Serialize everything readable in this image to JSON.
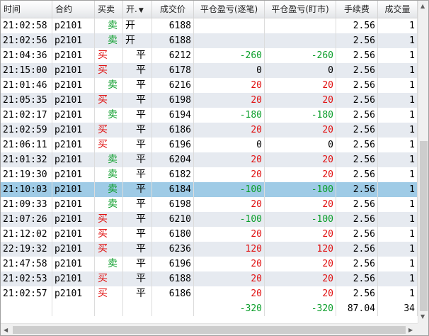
{
  "columns": [
    {
      "key": "time",
      "label": "时间",
      "width": 73
    },
    {
      "key": "contract",
      "label": "合约",
      "width": 60
    },
    {
      "key": "side",
      "label": "买卖",
      "width": 40
    },
    {
      "key": "oc",
      "label": "开.",
      "width": 41
    },
    {
      "key": "price",
      "label": "成交价",
      "width": 59
    },
    {
      "key": "pnl_trade",
      "label": "平仓盈亏(逐笔)",
      "width": 100
    },
    {
      "key": "pnl_mark",
      "label": "平仓盈亏(盯市)",
      "width": 101
    },
    {
      "key": "fee",
      "label": "手续费",
      "width": 59
    },
    {
      "key": "qty",
      "label": "成交量",
      "width": 56
    }
  ],
  "sort_indicator": "▼",
  "rows": [
    {
      "time": "21:02:58",
      "contract": "p2101",
      "side": "卖",
      "oc": "开",
      "price": "6188",
      "pnl_trade": "",
      "pnl_mark": "",
      "fee": "2.56",
      "qty": "1"
    },
    {
      "time": "21:02:56",
      "contract": "p2101",
      "side": "卖",
      "oc": "开",
      "price": "6188",
      "pnl_trade": "",
      "pnl_mark": "",
      "fee": "2.56",
      "qty": "1"
    },
    {
      "time": "21:04:36",
      "contract": "p2101",
      "side": "买",
      "oc": "平",
      "price": "6212",
      "pnl_trade": "-260",
      "pnl_mark": "-260",
      "fee": "2.56",
      "qty": "1"
    },
    {
      "time": "21:15:00",
      "contract": "p2101",
      "side": "买",
      "oc": "平",
      "price": "6178",
      "pnl_trade": "0",
      "pnl_mark": "0",
      "fee": "2.56",
      "qty": "1"
    },
    {
      "time": "21:01:46",
      "contract": "p2101",
      "side": "卖",
      "oc": "平",
      "price": "6216",
      "pnl_trade": "20",
      "pnl_mark": "20",
      "fee": "2.56",
      "qty": "1"
    },
    {
      "time": "21:05:35",
      "contract": "p2101",
      "side": "买",
      "oc": "平",
      "price": "6198",
      "pnl_trade": "20",
      "pnl_mark": "20",
      "fee": "2.56",
      "qty": "1"
    },
    {
      "time": "21:02:17",
      "contract": "p2101",
      "side": "卖",
      "oc": "平",
      "price": "6194",
      "pnl_trade": "-180",
      "pnl_mark": "-180",
      "fee": "2.56",
      "qty": "1"
    },
    {
      "time": "21:02:59",
      "contract": "p2101",
      "side": "买",
      "oc": "平",
      "price": "6186",
      "pnl_trade": "20",
      "pnl_mark": "20",
      "fee": "2.56",
      "qty": "1"
    },
    {
      "time": "21:06:11",
      "contract": "p2101",
      "side": "买",
      "oc": "平",
      "price": "6196",
      "pnl_trade": "0",
      "pnl_mark": "0",
      "fee": "2.56",
      "qty": "1"
    },
    {
      "time": "21:01:32",
      "contract": "p2101",
      "side": "卖",
      "oc": "平",
      "price": "6204",
      "pnl_trade": "20",
      "pnl_mark": "20",
      "fee": "2.56",
      "qty": "1"
    },
    {
      "time": "21:19:30",
      "contract": "p2101",
      "side": "卖",
      "oc": "平",
      "price": "6182",
      "pnl_trade": "20",
      "pnl_mark": "20",
      "fee": "2.56",
      "qty": "1"
    },
    {
      "time": "21:10:03",
      "contract": "p2101",
      "side": "卖",
      "oc": "平",
      "price": "6184",
      "pnl_trade": "-100",
      "pnl_mark": "-100",
      "fee": "2.56",
      "qty": "1",
      "selected": true
    },
    {
      "time": "21:09:33",
      "contract": "p2101",
      "side": "卖",
      "oc": "平",
      "price": "6198",
      "pnl_trade": "20",
      "pnl_mark": "20",
      "fee": "2.56",
      "qty": "1"
    },
    {
      "time": "21:07:26",
      "contract": "p2101",
      "side": "买",
      "oc": "平",
      "price": "6210",
      "pnl_trade": "-100",
      "pnl_mark": "-100",
      "fee": "2.56",
      "qty": "1"
    },
    {
      "time": "21:12:02",
      "contract": "p2101",
      "side": "买",
      "oc": "平",
      "price": "6180",
      "pnl_trade": "20",
      "pnl_mark": "20",
      "fee": "2.56",
      "qty": "1"
    },
    {
      "time": "22:19:32",
      "contract": "p2101",
      "side": "买",
      "oc": "平",
      "price": "6236",
      "pnl_trade": "120",
      "pnl_mark": "120",
      "fee": "2.56",
      "qty": "1"
    },
    {
      "time": "21:47:58",
      "contract": "p2101",
      "side": "卖",
      "oc": "平",
      "price": "6196",
      "pnl_trade": "20",
      "pnl_mark": "20",
      "fee": "2.56",
      "qty": "1"
    },
    {
      "time": "21:02:53",
      "contract": "p2101",
      "side": "买",
      "oc": "平",
      "price": "6188",
      "pnl_trade": "20",
      "pnl_mark": "20",
      "fee": "2.56",
      "qty": "1"
    },
    {
      "time": "21:02:57",
      "contract": "p2101",
      "side": "买",
      "oc": "平",
      "price": "6186",
      "pnl_trade": "20",
      "pnl_mark": "20",
      "fee": "2.56",
      "qty": "1"
    }
  ],
  "totals": {
    "time": "",
    "contract": "",
    "side": "",
    "oc": "",
    "price": "",
    "pnl_trade": "-320",
    "pnl_mark": "-320",
    "fee": "87.04",
    "qty": "34"
  },
  "colors": {
    "buy": "#e01010",
    "sell": "#0a9e2a",
    "profit": "#e01010",
    "loss": "#0a9e2a",
    "selected_row": "#9fcbe6",
    "alt_row": "#e6eaf0"
  }
}
